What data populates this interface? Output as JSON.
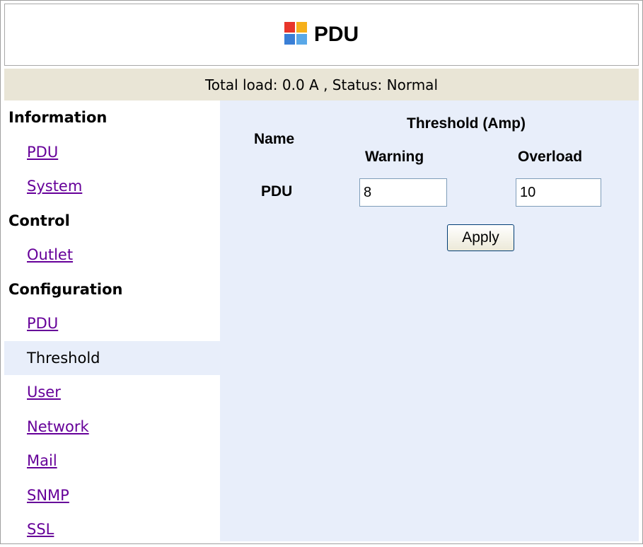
{
  "header": {
    "title": "PDU",
    "logo_icon": "pdu-app-icon"
  },
  "status": {
    "text": "Total load: 0.0 A , Status: Normal"
  },
  "sidebar": {
    "items": [
      {
        "label": "Information",
        "kind": "section"
      },
      {
        "label": "PDU",
        "kind": "link"
      },
      {
        "label": "System",
        "kind": "link"
      },
      {
        "label": "Control",
        "kind": "section"
      },
      {
        "label": "Outlet",
        "kind": "link"
      },
      {
        "label": "Configuration",
        "kind": "section"
      },
      {
        "label": "PDU",
        "kind": "link"
      },
      {
        "label": "Threshold",
        "kind": "active"
      },
      {
        "label": "User",
        "kind": "link"
      },
      {
        "label": "Network",
        "kind": "link"
      },
      {
        "label": "Mail",
        "kind": "link"
      },
      {
        "label": "SNMP",
        "kind": "link"
      },
      {
        "label": "SSL",
        "kind": "link"
      }
    ]
  },
  "threshold": {
    "name_header": "Name",
    "threshold_header": "Threshold (Amp)",
    "warning_header": "Warning",
    "overload_header": "Overload",
    "row": {
      "name": "PDU",
      "warning_value": "8",
      "overload_value": "10"
    },
    "apply_label": "Apply"
  },
  "colors": {
    "status_bar_bg": "#e9e5d6",
    "content_bg": "#e8eefa",
    "link_color": "#660099"
  }
}
